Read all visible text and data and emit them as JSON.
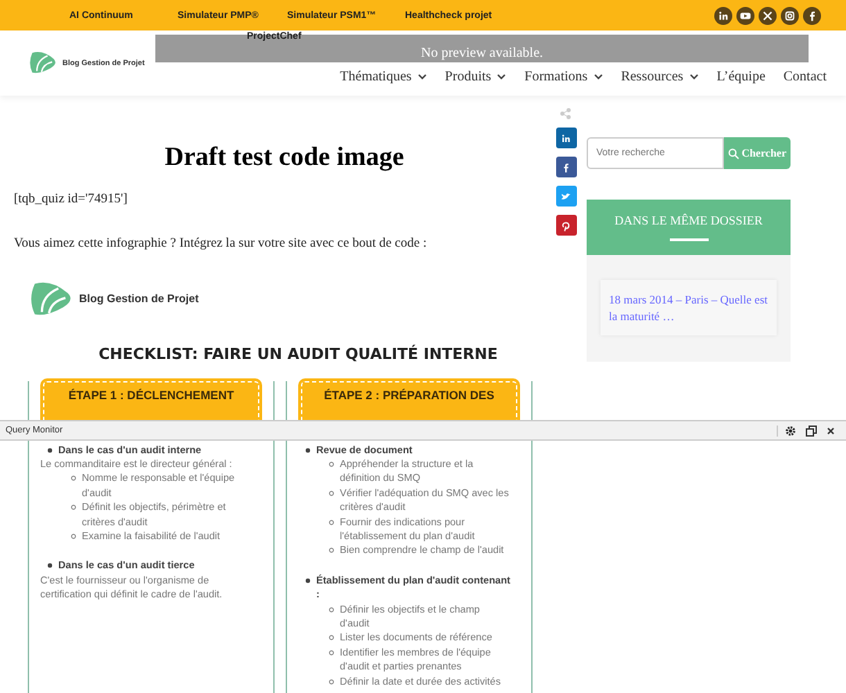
{
  "top_links": [
    {
      "label": "AI Continuum"
    },
    {
      "label": "Simulateur PMP®"
    },
    {
      "label": "Simulateur PSM1™"
    },
    {
      "label": "Healthcheck projet"
    },
    {
      "label": "ProjectChef"
    }
  ],
  "social": [
    {
      "kind": "linkedin"
    },
    {
      "kind": "youtube"
    },
    {
      "kind": "x"
    },
    {
      "kind": "instagram"
    },
    {
      "kind": "facebook"
    }
  ],
  "header": {
    "logo": "Blog Gestion de Projet",
    "preview": "No preview available.",
    "nav": [
      {
        "label": "Thématiques",
        "dropdown": true
      },
      {
        "label": "Produits",
        "dropdown": true
      },
      {
        "label": "Formations",
        "dropdown": true
      },
      {
        "label": "Ressources",
        "dropdown": true
      },
      {
        "label": "L’équipe",
        "dropdown": false
      },
      {
        "label": "Contact",
        "dropdown": false
      }
    ]
  },
  "article": {
    "title": "Draft test code image",
    "shortcode": "[tqb_quiz id='74915']",
    "intro": "Vous aimez cette infographie ? Intégrez la sur votre site avec ce bout de code :",
    "infographic": {
      "logo": "Blog Gestion de Projet",
      "title": "CHECKLIST: FAIRE UN AUDIT QUALITÉ INTERNE",
      "steps": [
        {
          "title": "ÉTAPE 1 : DÉCLENCHEMENT",
          "sections": [
            {
              "heading": "Dans le cas d'un audit interne",
              "text": "Le commanditaire est le directeur général :",
              "items": [
                "Nomme le responsable et l'équipe d'audit",
                "Définit les objectifs, périmètre et critères d'audit",
                "Examine la faisabilité de l'audit"
              ]
            },
            {
              "heading": "Dans le cas d'un audit tierce",
              "text": "C'est le fournisseur ou l'organisme de certification qui définit le cadre de l'audit."
            }
          ]
        },
        {
          "title": "ÉTAPE 2 : PRÉPARATION DES",
          "sections": [
            {
              "heading": "Revue de document",
              "items": [
                "Appréhender la structure et la définition du SMQ",
                "Vérifier l'adéquation du SMQ avec les critères d'audit",
                "Fournir des indications pour l'établissement du plan d'audit",
                "Bien comprendre le champ de l'audit"
              ]
            },
            {
              "heading": "Établissement du plan d'audit contenant :",
              "items": [
                "Définir les objectifs et le champ d'audit",
                "Lister les documents de référence",
                "Identifier les membres de l'équipe d'audit et parties prenantes",
                "Définir la date et durée des activités"
              ]
            }
          ]
        }
      ]
    }
  },
  "share": [
    {
      "kind": "linkedin"
    },
    {
      "kind": "facebook"
    },
    {
      "kind": "twitter"
    },
    {
      "kind": "pinterest"
    }
  ],
  "sidebar": {
    "search": {
      "placeholder": "Votre recherche",
      "button": "Chercher"
    },
    "dossier": {
      "title": "DANS LE MÊME DOSSIER",
      "links": [
        "18 mars 2014 – Paris – Quelle est la maturité …"
      ]
    }
  },
  "query_monitor": {
    "title": "Query Monitor"
  }
}
